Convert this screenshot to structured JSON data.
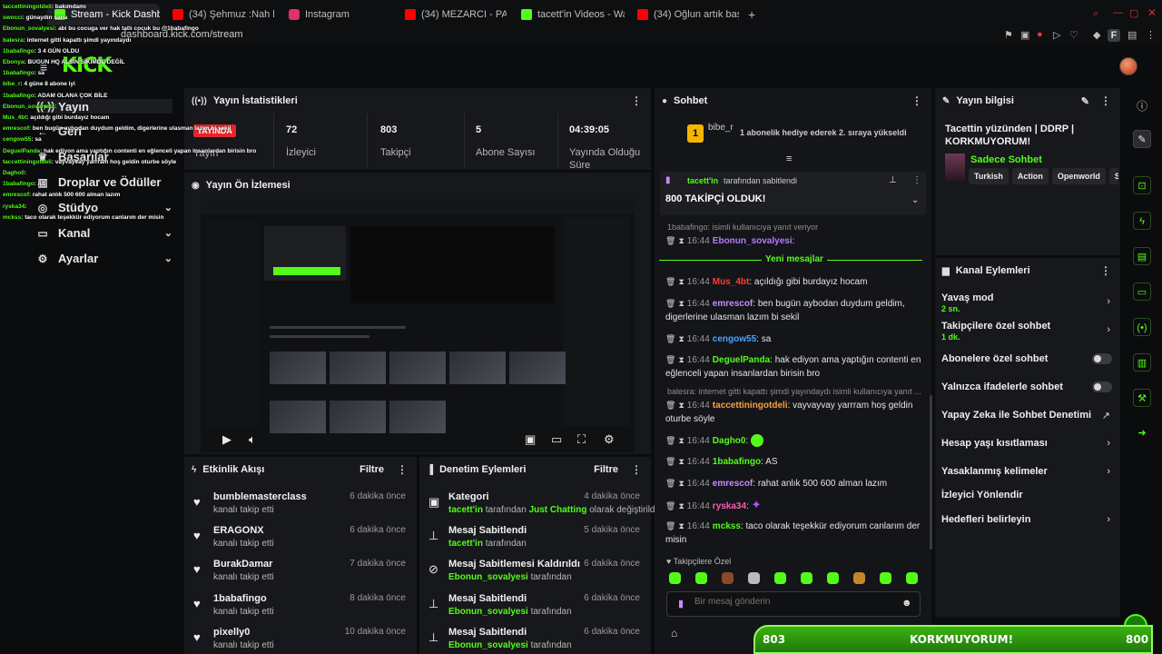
{
  "browser": {
    "tabs": [
      {
        "label": "Stream - Kick Dashboard",
        "icon": "kick-icon",
        "color": "#53fc18"
      },
      {
        "label": "(34) Şehmuz :Nah bu kad",
        "icon": "youtube-icon",
        "color": "#ff0000"
      },
      {
        "label": "Instagram",
        "icon": "instagram-icon",
        "color": "#e1306c"
      },
      {
        "label": "(34) MEZARCI - PARA BE",
        "icon": "youtube-icon",
        "color": "#ff0000"
      },
      {
        "label": "tacett'in Videos - Watch C",
        "icon": "kick-icon",
        "color": "#53fc18"
      },
      {
        "label": "(34) Oğlun artık başardı a",
        "icon": "youtube-icon",
        "color": "#ff0000"
      }
    ],
    "new_tab": "+",
    "url": "dashboard.kick.com/stream",
    "profile_letter": "F"
  },
  "app": {
    "logo": "KICK"
  },
  "sidebar": {
    "items": [
      {
        "label": "Yayın",
        "icon": "broadcast-icon"
      },
      {
        "label": "Geri",
        "icon": "back-icon"
      },
      {
        "label": "Başarılar",
        "icon": "trophy-icon"
      },
      {
        "label": "Droplar ve Ödüller",
        "icon": "gift-icon"
      },
      {
        "label": "Stüdyo",
        "icon": "studio-icon"
      },
      {
        "label": "Kanal",
        "icon": "channel-icon"
      },
      {
        "label": "Ayarlar",
        "icon": "gear-icon"
      }
    ]
  },
  "stats": {
    "title": "Yayın İstatistikleri",
    "status_badge": "YAYINDA",
    "status_label": "Yayın",
    "items": [
      {
        "value": "72",
        "label": "İzleyici"
      },
      {
        "value": "803",
        "label": "Takipçi"
      },
      {
        "value": "5",
        "label": "Abone Sayısı"
      },
      {
        "value": "04:39:05",
        "label": "Yayında Olduğu Süre"
      }
    ]
  },
  "preview": {
    "title": "Yayın Ön İzlemesi"
  },
  "activity": {
    "title": "Etkinlik Akışı",
    "filter": "Filtre",
    "rows": [
      {
        "name": "bumblemasterclass",
        "sub": "kanalı takip etti",
        "time": "6 dakika önce"
      },
      {
        "name": "ERAGONX",
        "sub": "kanalı takip etti",
        "time": "6 dakika önce"
      },
      {
        "name": "BurakDamar",
        "sub": "kanalı takip etti",
        "time": "7 dakika önce"
      },
      {
        "name": "1babafingo",
        "sub": "kanalı takip etti",
        "time": "8 dakika önce"
      },
      {
        "name": "pixelly0",
        "sub": "kanalı takip etti",
        "time": "10 dakika önce"
      }
    ]
  },
  "moderation": {
    "title": "Denetim Eylemleri",
    "filter": "Filtre",
    "rows": [
      {
        "name": "Kategori",
        "actor": "tacett'in",
        "mid": "tarafından",
        "target": "Just Chatting",
        "end": "olarak değiştirildi",
        "time": "4 dakika önce"
      },
      {
        "name": "Mesaj Sabitlendi",
        "actor": "tacett'in",
        "mid": "tarafından",
        "target": "",
        "end": "",
        "time": "5 dakika önce"
      },
      {
        "name": "Mesaj Sabitlemesi Kaldırıldı",
        "actor": "Ebonun_sovalyesi",
        "mid": "tarafından",
        "target": "",
        "end": "",
        "time": "6 dakika önce"
      },
      {
        "name": "Mesaj Sabitlendi",
        "actor": "Ebonun_sovalyesi",
        "mid": "tarafından",
        "target": "",
        "end": "",
        "time": "6 dakika önce"
      },
      {
        "name": "Mesaj Sabitlendi",
        "actor": "Ebonun_sovalyesi",
        "mid": "tarafından",
        "target": "",
        "end": "",
        "time": "6 dakika önce"
      }
    ]
  },
  "chat": {
    "title": "Sohbet",
    "gift_user": "bibe_r",
    "gift_text": "1 abonelik hediye ederek 2. sıraya yükseldi",
    "pinned_by": "tacett'in",
    "pinned_label": "tarafından sabitlendi",
    "pinned_text": "800 TAKİPÇİ OLDUK!",
    "reply_hint": "1babafingo: isimli kullanıcıya yanıt veriyor",
    "new_messages": "Yeni mesajlar",
    "messages": [
      {
        "time": "16:44",
        "user": "Ebonun_sovalyesi",
        "color": "#b57bff",
        "text": ""
      },
      {
        "time": "16:44",
        "user": "Mus_4bt",
        "color": "#ff3b3b",
        "text": "açıldığı gibi burdayız hocam"
      },
      {
        "time": "16:44",
        "user": "emrescof",
        "color": "#c98bff",
        "text": "ben bugün aybodan duydum geldim, digerlerine ulasman lazım bi sekil"
      },
      {
        "time": "16:44",
        "user": "cengow55",
        "color": "#4aa3ff",
        "text": "sa"
      },
      {
        "time": "16:44",
        "user": "DeguelPanda",
        "color": "#53fc18",
        "text": "hak ediyon ama yaptığın contenti en eğlenceli yapan insanlardan birisin bro"
      },
      {
        "time": "16:44",
        "user": "taccettiningotdeli",
        "color": "#ff9e3b",
        "text": "vayvayvay yarrram hoş geldin oturbe söyle"
      },
      {
        "time": "16:44",
        "user": "Dagho0",
        "color": "#53fc18",
        "text": ""
      },
      {
        "time": "16:44",
        "user": "1babafingo",
        "color": "#53fc18",
        "text": "AS"
      },
      {
        "time": "16:44",
        "user": "emrescof",
        "color": "#c98bff",
        "text": "rahat anlık 500 600 alman lazım"
      },
      {
        "time": "16:44",
        "user": "ryska34",
        "color": "#ff5ab5",
        "text": ""
      },
      {
        "time": "16:44",
        "user": "mckss",
        "color": "#53fc18",
        "text": "taco olarak teşekkür ediyorum canlarım der misin"
      }
    ],
    "system_line": "balesra: internet gitti kapattı şimdi yayındaydı isimli kullanıcıya yanıt ...",
    "emote_label": "Takipçilere Özel",
    "input_placeholder": "Bir mesaj gönderin"
  },
  "stream_info": {
    "title": "Yayın bilgisi",
    "stream_title": "Tacettin yüzünden | DDRP | KORKMUYORUM!",
    "category": "Sadece Sohbet",
    "tags": [
      "Turkish",
      "Action",
      "Openworld",
      "S"
    ]
  },
  "channel_actions": {
    "title": "Kanal Eylemleri",
    "rows": [
      {
        "label": "Yavaş mod",
        "sub": "2 sn.",
        "control": "chevron"
      },
      {
        "label": "Takipçilere özel sohbet",
        "sub": "1 dk.",
        "control": "chevron"
      },
      {
        "label": "Abonelere özel sohbet",
        "sub": "",
        "control": "toggle"
      },
      {
        "label": "Yalnızca ifadelerle sohbet",
        "sub": "",
        "control": "toggle"
      },
      {
        "label": "Yapay Zeka ile Sohbet Denetimi",
        "sub": "",
        "control": "external"
      },
      {
        "label": "Hesap yaşı kısıtlaması",
        "sub": "",
        "control": "chevron"
      },
      {
        "label": "Yasaklanmış kelimeler",
        "sub": "",
        "control": "chevron"
      },
      {
        "label": "İzleyici Yönlendir",
        "sub": "",
        "control": "none"
      },
      {
        "label": "Hedefleri belirleyin",
        "sub": "",
        "control": "chevron"
      }
    ]
  },
  "overlay_chat": [
    {
      "u": "taccettiningotdeli",
      "t": "bakımdamı"
    },
    {
      "u": "swocci",
      "t": "günaydın sana"
    },
    {
      "u": "Ebonun_sovalyesi",
      "t": "abi bu cocuga ver hak tatlı cocuk bu @1babafingo"
    },
    {
      "u": "balesra",
      "t": "internet gitti kapattı şimdi yayındaydı"
    },
    {
      "u": "1babafingo",
      "t": "3 4 GÜN OLDU"
    },
    {
      "u": "Ebonya",
      "t": "BUGUN HQ ALSIN SİKİMDE DEĞİL"
    },
    {
      "u": "1babafingo",
      "t": "sa"
    },
    {
      "u": "bibe_r",
      "t": "4 güne 8 abone iyi"
    },
    {
      "u": "1babafingo",
      "t": "ADAM OLANA ÇOK BİLE"
    },
    {
      "u": "Ebonun_sovalyesi",
      "t": ""
    },
    {
      "u": "Mus_4bt",
      "t": "açıldığı gibi burdayız hocam"
    },
    {
      "u": "emrescof",
      "t": "ben bugün aybodan duydum geldim, digerlerine ulasman lazım bi sekil"
    },
    {
      "u": "cengow55",
      "t": "sa"
    },
    {
      "u": "DeguelPanda",
      "t": "hak ediyon ama yaptığın contenti en eğlenceli yapan insanlardan birisin bro"
    },
    {
      "u": "taccettiningotdeli",
      "t": "vayvayvay yarrram hoş geldin oturbe söyle"
    },
    {
      "u": "Dagho0",
      "t": ""
    },
    {
      "u": "1babafingo",
      "t": "AS"
    },
    {
      "u": "emrescof",
      "t": "rahat anlık 500 600 alman lazım"
    },
    {
      "u": "ryska34",
      "t": ""
    },
    {
      "u": "mckss",
      "t": "taco olarak teşekkür ediyorum canlarım der misin"
    }
  ],
  "banner": {
    "left": "803",
    "center": "KORKMUYORUM!",
    "right": "800"
  },
  "colors": {
    "accent": "#53fc18",
    "live": "#e5262b",
    "panel": "#17181b",
    "bg": "#0b0c0e"
  }
}
